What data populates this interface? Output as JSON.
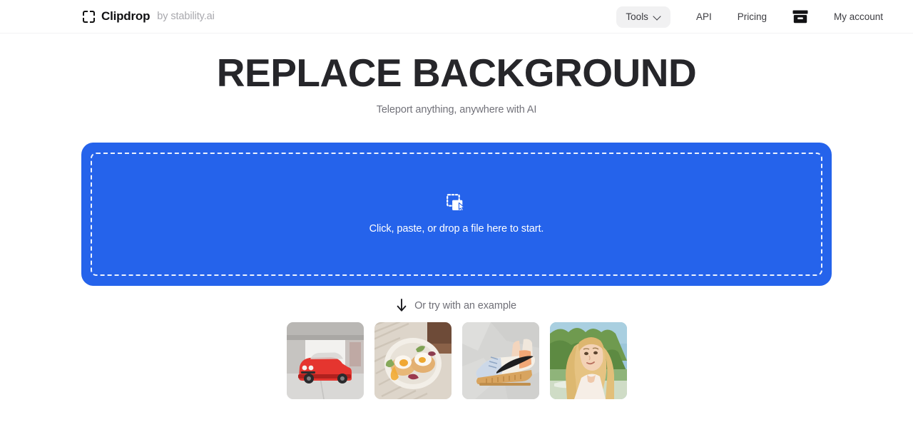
{
  "navbar": {
    "brand_name": "Clipdrop",
    "brand_suffix": "by stability.ai",
    "brand_icon": "clipdrop-frame-icon",
    "tools": {
      "label": "Tools",
      "icon": "chevron-down-icon"
    },
    "links": [
      {
        "label": "API"
      },
      {
        "label": "Pricing"
      }
    ],
    "archive_icon": "archive-box-icon",
    "account_label": "My account"
  },
  "hero": {
    "title": "REPLACE BACKGROUND",
    "subtitle": "Teleport anything, anywhere with AI"
  },
  "dropzone": {
    "icon": "drag-drop-cursor-icon",
    "text": "Click, paste, or drop a file here to start.",
    "accent_color": "#2563eb"
  },
  "examples": {
    "hint_icon": "arrow-down-icon",
    "hint_text": "Or try with an example",
    "items": [
      {
        "name": "example-red-car",
        "alt": "Red muscle car under a concrete overpass"
      },
      {
        "name": "example-eggs-benedict",
        "alt": "Eggs benedict on a white plate over striped cloth"
      },
      {
        "name": "example-sneaker",
        "alt": "Nike high-top sneaker on crumpled grey paper"
      },
      {
        "name": "example-portrait",
        "alt": "Blonde woman portrait outdoors with green foliage"
      }
    ]
  }
}
